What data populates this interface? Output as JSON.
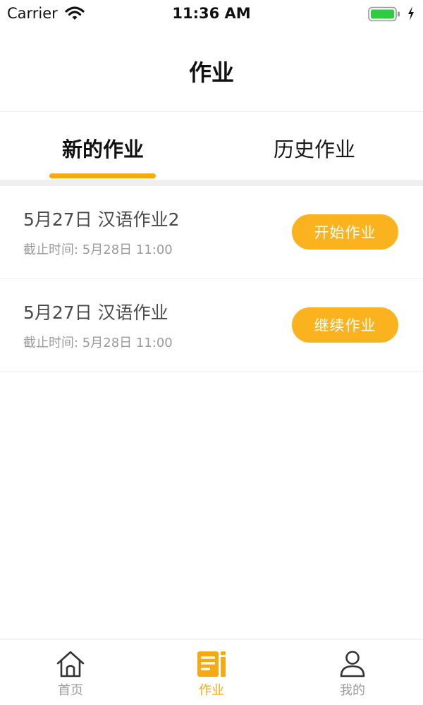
{
  "status_bar": {
    "carrier": "Carrier",
    "time": "11:36 AM",
    "battery_color": "#2ecc40"
  },
  "nav": {
    "title": "作业"
  },
  "tabs": [
    {
      "label": "新的作业",
      "active": true
    },
    {
      "label": "历史作业",
      "active": false
    }
  ],
  "assignments": [
    {
      "title": "5月27日 汉语作业2",
      "deadline": "截止时间: 5月28日 11:00",
      "button_label": "开始作业"
    },
    {
      "title": "5月27日 汉语作业",
      "deadline": "截止时间: 5月28日 11:00",
      "button_label": "继续作业"
    }
  ],
  "tab_bar": [
    {
      "label": "首页",
      "icon": "home-icon",
      "active": false
    },
    {
      "label": "作业",
      "icon": "homework-icon",
      "active": true
    },
    {
      "label": "我的",
      "icon": "user-icon",
      "active": false
    }
  ],
  "colors": {
    "accent": "#f5a914",
    "button": "#fbb21f"
  }
}
